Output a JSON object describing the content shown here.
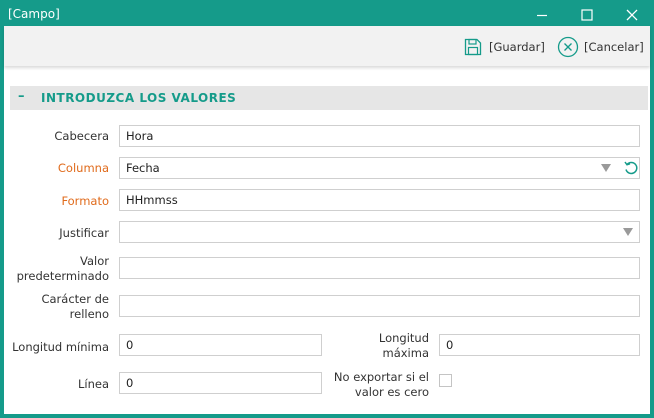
{
  "window": {
    "title": "[Campo]"
  },
  "toolbar": {
    "save_label": "[Guardar]",
    "cancel_label": "[Cancelar]"
  },
  "section": {
    "collapse_symbol": "–",
    "title": "INTRODUZCA LOS VALORES"
  },
  "form": {
    "cabecera": {
      "label": "Cabecera",
      "value": "Hora"
    },
    "columna": {
      "label": "Columna",
      "value": "Fecha"
    },
    "formato": {
      "label": "Formato",
      "value": "HHmmss"
    },
    "justificar": {
      "label": "Justificar",
      "value": ""
    },
    "valor_predeterminado": {
      "label_line1": "Valor",
      "label_line2": "predeterminado",
      "value": ""
    },
    "caracter_relleno": {
      "label_line1": "Carácter de",
      "label_line2": "relleno",
      "value": ""
    },
    "longitud_minima": {
      "label": "Longitud mínima",
      "value": "0"
    },
    "longitud_maxima": {
      "label_line1": "Longitud",
      "label_line2": "máxima",
      "value": "0"
    },
    "linea": {
      "label": "Línea",
      "value": "0"
    },
    "no_exportar": {
      "label_line1": "No exportar si el",
      "label_line2": "valor es cero",
      "checked": false
    }
  },
  "colors": {
    "accent": "#159b8a",
    "required_label": "#e06b1c"
  }
}
